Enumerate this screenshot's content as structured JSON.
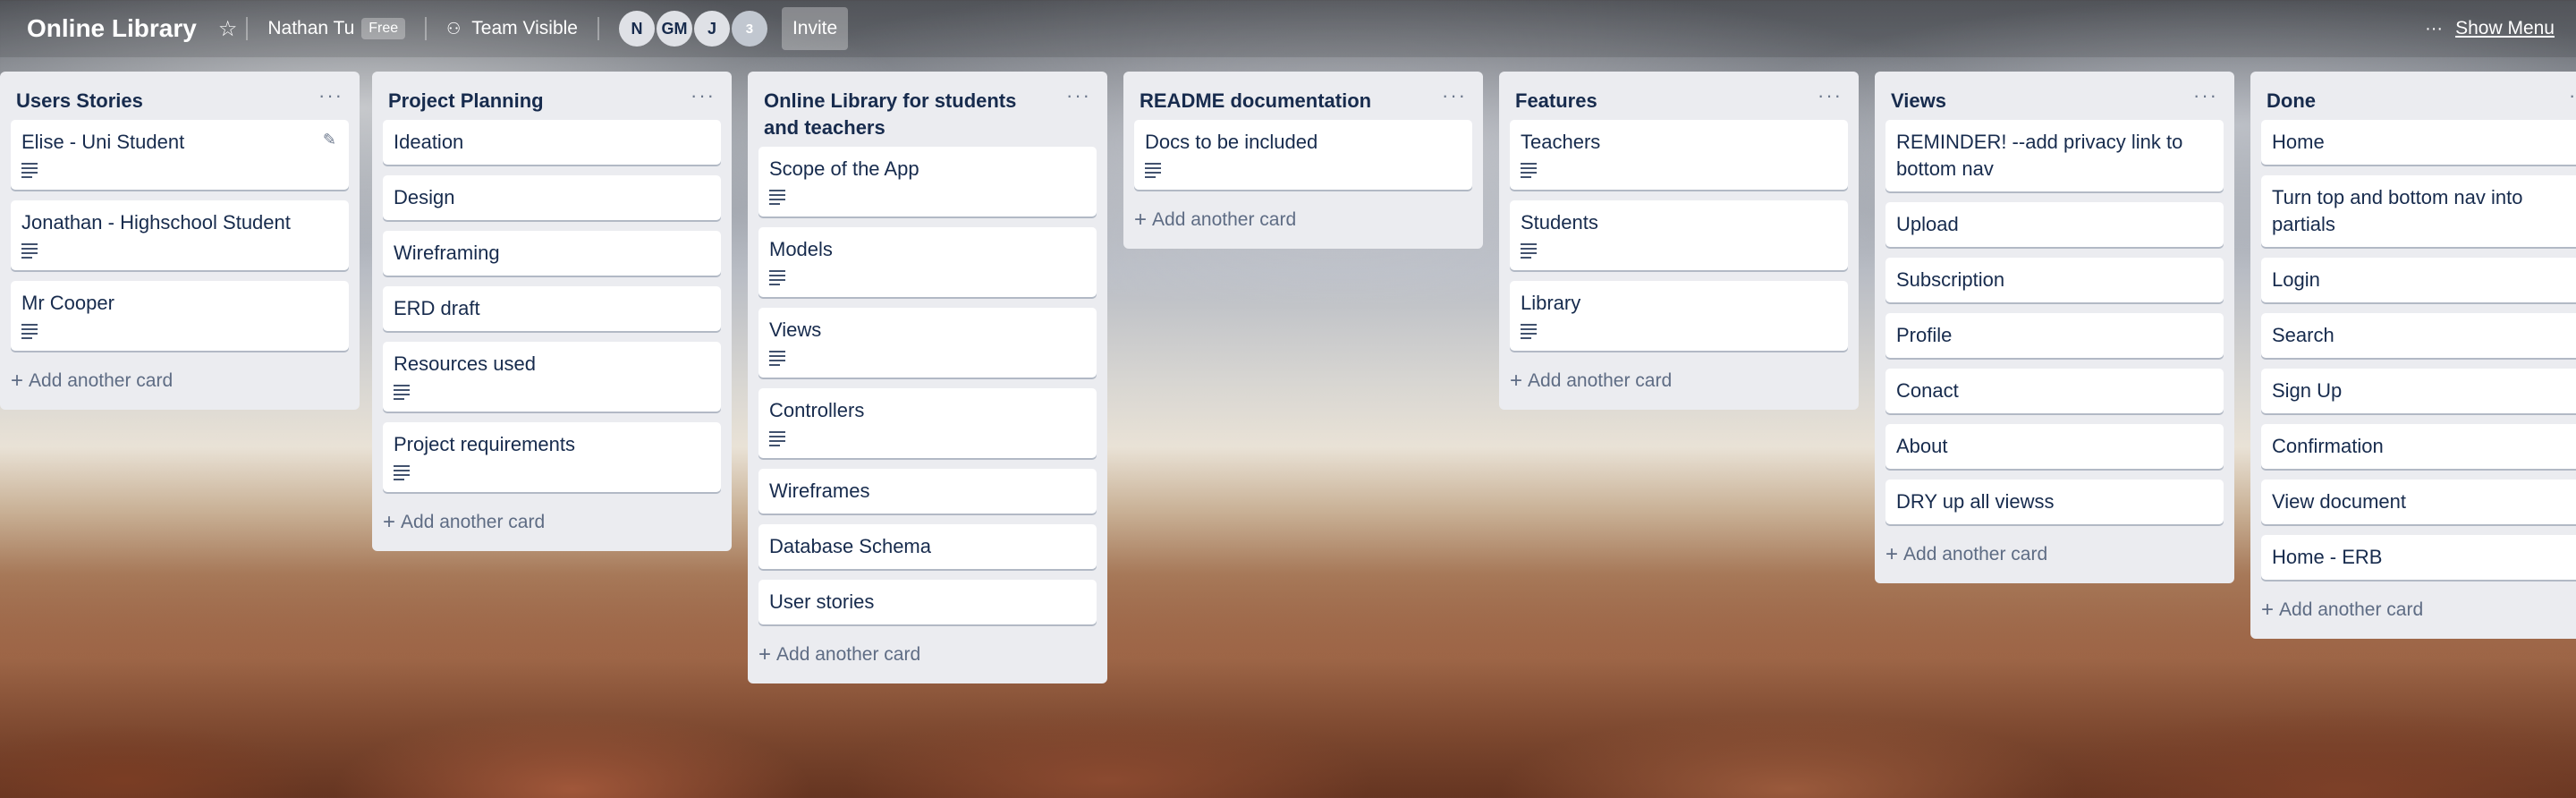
{
  "header": {
    "board_title": "Online Library",
    "user_name": "Nathan Tu",
    "plan_badge": "Free",
    "visibility": "Team Visible",
    "members": [
      "N",
      "GM",
      "J"
    ],
    "member_overflow": "3",
    "invite_label": "Invite",
    "show_menu_label": "Show Menu"
  },
  "add_card_label": "Add another card",
  "lists": [
    {
      "title": "Users Stories",
      "cards": [
        {
          "title": "Elise - Uni Student",
          "has_description": true
        },
        {
          "title": "Jonathan - Highschool Student",
          "has_description": true
        },
        {
          "title": "Mr Cooper",
          "has_description": true
        }
      ]
    },
    {
      "title": "Project Planning",
      "cards": [
        {
          "title": "Ideation"
        },
        {
          "title": "Design"
        },
        {
          "title": "Wireframing"
        },
        {
          "title": "ERD draft"
        },
        {
          "title": "Resources used",
          "has_description": true
        },
        {
          "title": "Project requirements",
          "has_description": true
        }
      ]
    },
    {
      "title": "Online Library for students and teachers",
      "cards": [
        {
          "title": "Scope of the App",
          "has_description": true
        },
        {
          "title": "Models",
          "has_description": true
        },
        {
          "title": "Views",
          "has_description": true
        },
        {
          "title": "Controllers",
          "has_description": true
        },
        {
          "title": "Wireframes"
        },
        {
          "title": "Database Schema"
        },
        {
          "title": "User stories"
        }
      ]
    },
    {
      "title": "README documentation",
      "cards": [
        {
          "title": "Docs to be included",
          "has_description": true
        }
      ]
    },
    {
      "title": "Features",
      "cards": [
        {
          "title": "Teachers",
          "has_description": true
        },
        {
          "title": "Students",
          "has_description": true
        },
        {
          "title": "Library",
          "has_description": true
        }
      ]
    },
    {
      "title": "Views",
      "cards": [
        {
          "title": "REMINDER! --add privacy link to bottom nav"
        },
        {
          "title": "Upload"
        },
        {
          "title": "Subscription"
        },
        {
          "title": "Profile"
        },
        {
          "title": "Conact"
        },
        {
          "title": "About"
        },
        {
          "title": "DRY up all viewss"
        }
      ]
    },
    {
      "title": "Done",
      "cards": [
        {
          "title": "Home"
        },
        {
          "title": "Turn top and bottom nav into partials"
        },
        {
          "title": "Login"
        },
        {
          "title": "Search"
        },
        {
          "title": "Sign Up"
        },
        {
          "title": "Confirmation"
        },
        {
          "title": "View document"
        },
        {
          "title": "Home - ERB"
        }
      ]
    }
  ]
}
